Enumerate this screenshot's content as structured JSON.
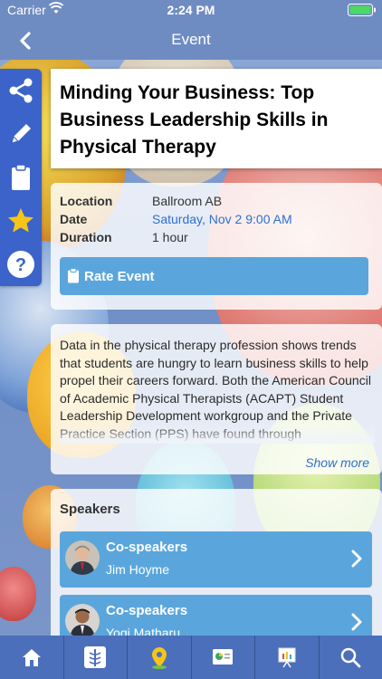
{
  "status_bar": {
    "carrier": "Carrier",
    "time": "2:24 PM"
  },
  "nav": {
    "title": "Event"
  },
  "sidebar": {
    "items": [
      {
        "icon": "share-icon"
      },
      {
        "icon": "pencil-icon"
      },
      {
        "icon": "clipboard-icon"
      },
      {
        "icon": "star-icon"
      },
      {
        "icon": "help-icon"
      }
    ]
  },
  "event": {
    "title": "Minding Your Business: Top Business Leadership Skills in Physical Therapy",
    "location_label": "Location",
    "location_value": "Ballroom AB",
    "date_label": "Date",
    "date_value": "Saturday, Nov 2 9:00 AM",
    "duration_label": "Duration",
    "duration_value": "1 hour",
    "rate_label": "Rate Event"
  },
  "description": {
    "text": "Data in the physical therapy profession shows trends that students are hungry to learn business skills to help propel their careers forward. Both the American Council of Academic Physical Therapists (ACAPT) Student Leadership Development workgroup and the Private Practice Section (PPS) have found through",
    "show_more": "Show more"
  },
  "speakers": {
    "title": "Speakers",
    "items": [
      {
        "role": "Co-speakers",
        "name": "Jim Hoyme"
      },
      {
        "role": "Co-speakers",
        "name": "Yogi Matharu"
      }
    ]
  },
  "tabbar": {
    "items": [
      {
        "icon": "home-icon"
      },
      {
        "icon": "caduceus-icon"
      },
      {
        "icon": "map-pin-icon"
      },
      {
        "icon": "poster-icon"
      },
      {
        "icon": "presentation-icon"
      },
      {
        "icon": "search-icon"
      }
    ]
  },
  "colors": {
    "nav_bar": "#6f8cc2",
    "sidebar": "#3b63c9",
    "button": "#5aa6dc",
    "link": "#2d6fd0",
    "tab_bar": "#4b6fba",
    "star": "#f5c518"
  }
}
